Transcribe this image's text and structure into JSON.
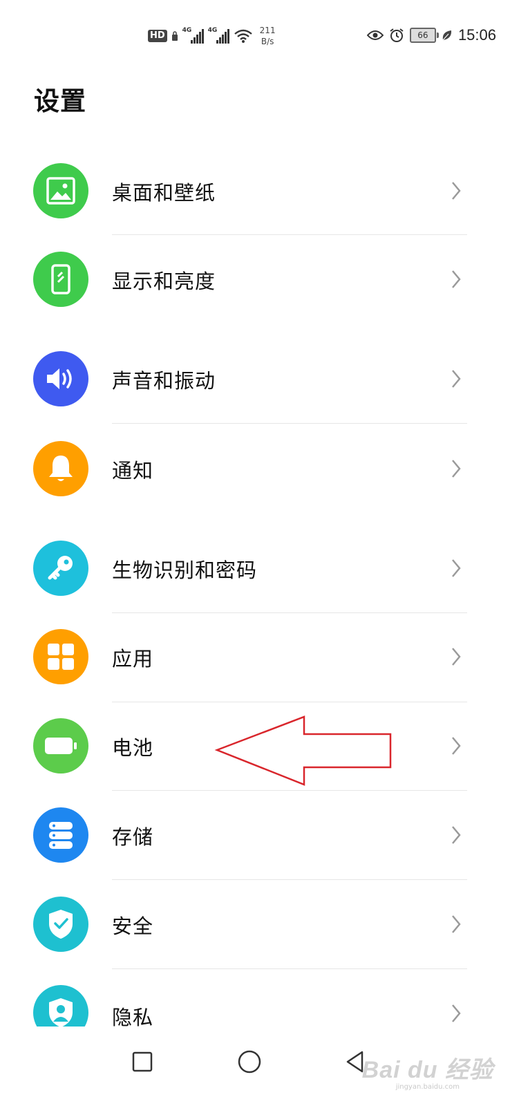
{
  "status_bar": {
    "hd_badge": "HD",
    "signal_tags": [
      "4G",
      "4G"
    ],
    "net_speed_value": "211",
    "net_speed_unit": "B/s",
    "battery_level": "66",
    "time": "15:06"
  },
  "page": {
    "title": "设置"
  },
  "settings_items": [
    {
      "label": "桌面和壁纸",
      "icon": "image-icon",
      "color": "#3fcb4c"
    },
    {
      "label": "显示和亮度",
      "icon": "phone-display-icon",
      "color": "#3fcb4c"
    },
    {
      "label": "声音和振动",
      "icon": "speaker-icon",
      "color": "#3f5af0"
    },
    {
      "label": "通知",
      "icon": "bell-icon",
      "color": "#ff9f00"
    },
    {
      "label": "生物识别和密码",
      "icon": "key-icon",
      "color": "#1ec0dc"
    },
    {
      "label": "应用",
      "icon": "apps-grid-icon",
      "color": "#ff9f00"
    },
    {
      "label": "电池",
      "icon": "battery-icon",
      "color": "#5ccc4b"
    },
    {
      "label": "存储",
      "icon": "storage-icon",
      "color": "#1e87f0"
    },
    {
      "label": "安全",
      "icon": "shield-check-icon",
      "color": "#1ec0d0"
    },
    {
      "label": "隐私",
      "icon": "privacy-shield-icon",
      "color": "#1ec0d0"
    }
  ],
  "annotation": {
    "arrow_color": "#d9262c",
    "target": "电池"
  },
  "nav_bar": {
    "buttons": [
      "recents-square-icon",
      "home-circle-icon",
      "back-triangle-icon"
    ]
  },
  "watermark": {
    "logo": "Bai du 经验",
    "url": "jingyan.baidu.com"
  }
}
